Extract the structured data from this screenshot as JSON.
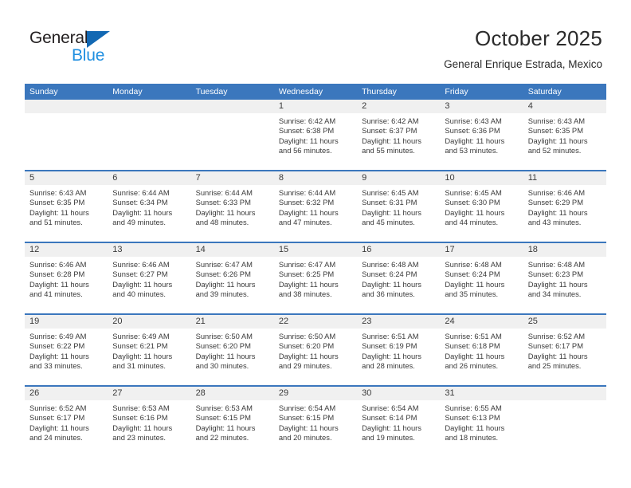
{
  "logo": {
    "word_top": "General",
    "word_bottom": "Blue",
    "triangle_color": "#1268b3",
    "blue_text_color": "#1f8fe0"
  },
  "header": {
    "title": "October 2025",
    "subtitle": "General Enrique Estrada, Mexico"
  },
  "theme": {
    "header_blue": "#3b77bd",
    "day_band_gray": "#f0f0f0",
    "text_color": "#3a3a3a"
  },
  "weekdays": [
    "Sunday",
    "Monday",
    "Tuesday",
    "Wednesday",
    "Thursday",
    "Friday",
    "Saturday"
  ],
  "labels": {
    "sunrise_prefix": "Sunrise:",
    "sunset_prefix": "Sunset:",
    "daylight_prefix": "Daylight:"
  },
  "weeks": [
    [
      {
        "day": "",
        "empty": true
      },
      {
        "day": "",
        "empty": true
      },
      {
        "day": "",
        "empty": true
      },
      {
        "day": "1",
        "sunrise": "Sunrise: 6:42 AM",
        "sunset": "Sunset: 6:38 PM",
        "daylight_l1": "Daylight: 11 hours",
        "daylight_l2": "and 56 minutes."
      },
      {
        "day": "2",
        "sunrise": "Sunrise: 6:42 AM",
        "sunset": "Sunset: 6:37 PM",
        "daylight_l1": "Daylight: 11 hours",
        "daylight_l2": "and 55 minutes."
      },
      {
        "day": "3",
        "sunrise": "Sunrise: 6:43 AM",
        "sunset": "Sunset: 6:36 PM",
        "daylight_l1": "Daylight: 11 hours",
        "daylight_l2": "and 53 minutes."
      },
      {
        "day": "4",
        "sunrise": "Sunrise: 6:43 AM",
        "sunset": "Sunset: 6:35 PM",
        "daylight_l1": "Daylight: 11 hours",
        "daylight_l2": "and 52 minutes."
      }
    ],
    [
      {
        "day": "5",
        "sunrise": "Sunrise: 6:43 AM",
        "sunset": "Sunset: 6:35 PM",
        "daylight_l1": "Daylight: 11 hours",
        "daylight_l2": "and 51 minutes."
      },
      {
        "day": "6",
        "sunrise": "Sunrise: 6:44 AM",
        "sunset": "Sunset: 6:34 PM",
        "daylight_l1": "Daylight: 11 hours",
        "daylight_l2": "and 49 minutes."
      },
      {
        "day": "7",
        "sunrise": "Sunrise: 6:44 AM",
        "sunset": "Sunset: 6:33 PM",
        "daylight_l1": "Daylight: 11 hours",
        "daylight_l2": "and 48 minutes."
      },
      {
        "day": "8",
        "sunrise": "Sunrise: 6:44 AM",
        "sunset": "Sunset: 6:32 PM",
        "daylight_l1": "Daylight: 11 hours",
        "daylight_l2": "and 47 minutes."
      },
      {
        "day": "9",
        "sunrise": "Sunrise: 6:45 AM",
        "sunset": "Sunset: 6:31 PM",
        "daylight_l1": "Daylight: 11 hours",
        "daylight_l2": "and 45 minutes."
      },
      {
        "day": "10",
        "sunrise": "Sunrise: 6:45 AM",
        "sunset": "Sunset: 6:30 PM",
        "daylight_l1": "Daylight: 11 hours",
        "daylight_l2": "and 44 minutes."
      },
      {
        "day": "11",
        "sunrise": "Sunrise: 6:46 AM",
        "sunset": "Sunset: 6:29 PM",
        "daylight_l1": "Daylight: 11 hours",
        "daylight_l2": "and 43 minutes."
      }
    ],
    [
      {
        "day": "12",
        "sunrise": "Sunrise: 6:46 AM",
        "sunset": "Sunset: 6:28 PM",
        "daylight_l1": "Daylight: 11 hours",
        "daylight_l2": "and 41 minutes."
      },
      {
        "day": "13",
        "sunrise": "Sunrise: 6:46 AM",
        "sunset": "Sunset: 6:27 PM",
        "daylight_l1": "Daylight: 11 hours",
        "daylight_l2": "and 40 minutes."
      },
      {
        "day": "14",
        "sunrise": "Sunrise: 6:47 AM",
        "sunset": "Sunset: 6:26 PM",
        "daylight_l1": "Daylight: 11 hours",
        "daylight_l2": "and 39 minutes."
      },
      {
        "day": "15",
        "sunrise": "Sunrise: 6:47 AM",
        "sunset": "Sunset: 6:25 PM",
        "daylight_l1": "Daylight: 11 hours",
        "daylight_l2": "and 38 minutes."
      },
      {
        "day": "16",
        "sunrise": "Sunrise: 6:48 AM",
        "sunset": "Sunset: 6:24 PM",
        "daylight_l1": "Daylight: 11 hours",
        "daylight_l2": "and 36 minutes."
      },
      {
        "day": "17",
        "sunrise": "Sunrise: 6:48 AM",
        "sunset": "Sunset: 6:24 PM",
        "daylight_l1": "Daylight: 11 hours",
        "daylight_l2": "and 35 minutes."
      },
      {
        "day": "18",
        "sunrise": "Sunrise: 6:48 AM",
        "sunset": "Sunset: 6:23 PM",
        "daylight_l1": "Daylight: 11 hours",
        "daylight_l2": "and 34 minutes."
      }
    ],
    [
      {
        "day": "19",
        "sunrise": "Sunrise: 6:49 AM",
        "sunset": "Sunset: 6:22 PM",
        "daylight_l1": "Daylight: 11 hours",
        "daylight_l2": "and 33 minutes."
      },
      {
        "day": "20",
        "sunrise": "Sunrise: 6:49 AM",
        "sunset": "Sunset: 6:21 PM",
        "daylight_l1": "Daylight: 11 hours",
        "daylight_l2": "and 31 minutes."
      },
      {
        "day": "21",
        "sunrise": "Sunrise: 6:50 AM",
        "sunset": "Sunset: 6:20 PM",
        "daylight_l1": "Daylight: 11 hours",
        "daylight_l2": "and 30 minutes."
      },
      {
        "day": "22",
        "sunrise": "Sunrise: 6:50 AM",
        "sunset": "Sunset: 6:20 PM",
        "daylight_l1": "Daylight: 11 hours",
        "daylight_l2": "and 29 minutes."
      },
      {
        "day": "23",
        "sunrise": "Sunrise: 6:51 AM",
        "sunset": "Sunset: 6:19 PM",
        "daylight_l1": "Daylight: 11 hours",
        "daylight_l2": "and 28 minutes."
      },
      {
        "day": "24",
        "sunrise": "Sunrise: 6:51 AM",
        "sunset": "Sunset: 6:18 PM",
        "daylight_l1": "Daylight: 11 hours",
        "daylight_l2": "and 26 minutes."
      },
      {
        "day": "25",
        "sunrise": "Sunrise: 6:52 AM",
        "sunset": "Sunset: 6:17 PM",
        "daylight_l1": "Daylight: 11 hours",
        "daylight_l2": "and 25 minutes."
      }
    ],
    [
      {
        "day": "26",
        "sunrise": "Sunrise: 6:52 AM",
        "sunset": "Sunset: 6:17 PM",
        "daylight_l1": "Daylight: 11 hours",
        "daylight_l2": "and 24 minutes."
      },
      {
        "day": "27",
        "sunrise": "Sunrise: 6:53 AM",
        "sunset": "Sunset: 6:16 PM",
        "daylight_l1": "Daylight: 11 hours",
        "daylight_l2": "and 23 minutes."
      },
      {
        "day": "28",
        "sunrise": "Sunrise: 6:53 AM",
        "sunset": "Sunset: 6:15 PM",
        "daylight_l1": "Daylight: 11 hours",
        "daylight_l2": "and 22 minutes."
      },
      {
        "day": "29",
        "sunrise": "Sunrise: 6:54 AM",
        "sunset": "Sunset: 6:15 PM",
        "daylight_l1": "Daylight: 11 hours",
        "daylight_l2": "and 20 minutes."
      },
      {
        "day": "30",
        "sunrise": "Sunrise: 6:54 AM",
        "sunset": "Sunset: 6:14 PM",
        "daylight_l1": "Daylight: 11 hours",
        "daylight_l2": "and 19 minutes."
      },
      {
        "day": "31",
        "sunrise": "Sunrise: 6:55 AM",
        "sunset": "Sunset: 6:13 PM",
        "daylight_l1": "Daylight: 11 hours",
        "daylight_l2": "and 18 minutes."
      },
      {
        "day": "",
        "empty": true
      }
    ]
  ]
}
